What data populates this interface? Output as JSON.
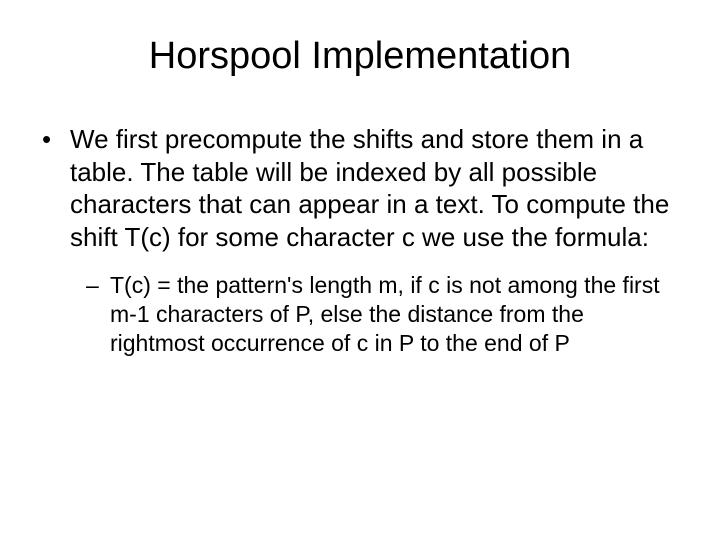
{
  "slide": {
    "title": "Horspool Implementation",
    "bullet1": "We first precompute the shifts and store them in a table.  The table will be indexed by all possible characters that can appear in a text.  To compute the shift T(c) for some character c we use the formula:",
    "bullet2": "T(c) =  the pattern's length m, if c is not among the first m-1 characters of P, else the distance from the rightmost occurrence of c in P to the end of P"
  }
}
